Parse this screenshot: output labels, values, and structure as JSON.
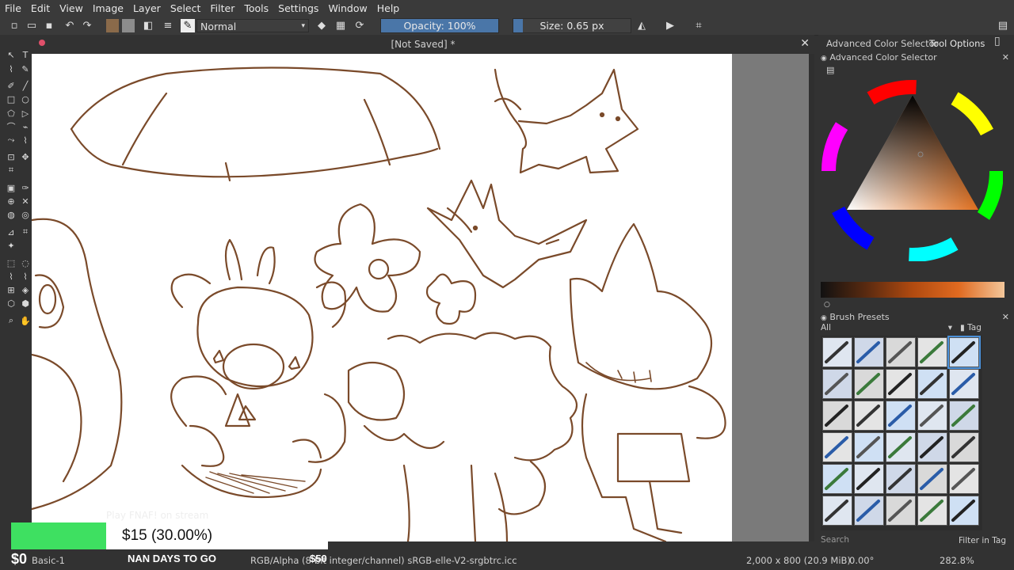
{
  "menu": [
    "File",
    "Edit",
    "View",
    "Image",
    "Layer",
    "Select",
    "Filter",
    "Tools",
    "Settings",
    "Window",
    "Help"
  ],
  "toolbar": {
    "blend_mode": "Normal",
    "opacity_label": "Opacity: 100%",
    "opacity_value": 1.0,
    "size_label": "Size: 0.65 px"
  },
  "document": {
    "title": "[Not Saved]",
    "modified_marker": "*"
  },
  "dock": {
    "tab_color_selector": "Advanced Color Selector",
    "tab_tool_options": "Tool Options",
    "color_panel_title": "Advanced Color Selector",
    "brush_panel_title": "Brush Presets",
    "brush_filter": "All",
    "tag_label": "Tag",
    "search_placeholder": "Search",
    "filter_in_tag": "Filter in Tag"
  },
  "colors": {
    "stroke": "#7a4a2a",
    "accent": "#4a76a8",
    "progress": "#3ee061"
  },
  "status": {
    "preset": "Basic-1",
    "color_space": "RGB/Alpha (8-bit integer/channel)  sRGB-elle-V2-srgbtrc.icc",
    "dimensions": "2,000 x 800 (20.9 MiB)",
    "rotation": "0.00°",
    "zoom": "282.8%"
  },
  "donation": {
    "amount": "$15 (30.00%)",
    "progress_fraction": 0.3,
    "start": "$0",
    "goal": "$50",
    "days_left": "NAN DAYS TO GO",
    "faded_text": "Play FNAF! on stream"
  }
}
